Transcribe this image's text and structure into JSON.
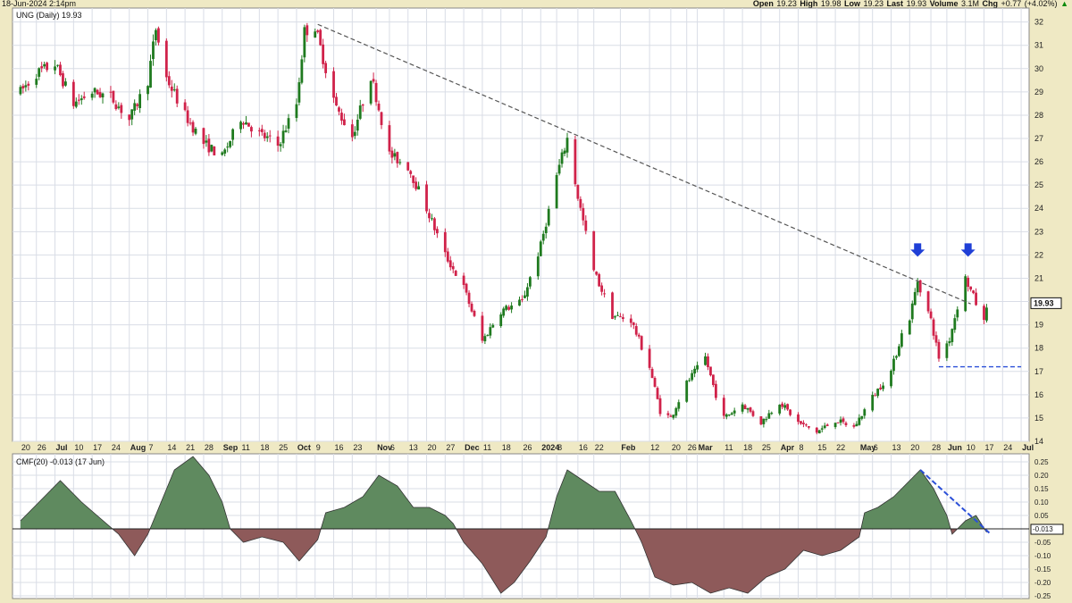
{
  "header": {
    "timestamp": "18-Jun-2024 2:14pm",
    "open_label": "Open",
    "open": "19.23",
    "high_label": "High",
    "high": "19.98",
    "low_label": "Low",
    "low": "19.23",
    "last_label": "Last",
    "last": "19.93",
    "volume_label": "Volume",
    "volume": "3.1M",
    "chg_label": "Chg",
    "chg": "+0.77 (+4.02%)",
    "chg_arrow": "▲"
  },
  "colors": {
    "background": "#efe9c4",
    "panel": "#ffffff",
    "grid": "#d9dde6",
    "up_candle": "#1f7a1f",
    "down_candle": "#d0224a",
    "trendline": "#555555",
    "arrow": "#1f3fd6",
    "support_line": "#2b4fd8",
    "cmf_positive": "#5f8a5f",
    "cmf_negative": "#8e5a5a",
    "header_up": "#0a8a0a"
  },
  "chart_data": [
    {
      "type": "candlestick",
      "title": "UNG (Daily) 19.93",
      "ylim": [
        14,
        32.6
      ],
      "yticks": [
        14,
        15,
        16,
        17,
        18,
        19,
        20,
        21,
        22,
        23,
        24,
        25,
        26,
        27,
        28,
        29,
        30,
        31,
        32
      ],
      "last_value_label": "19.93",
      "x_tick_labels": [
        "20",
        "26",
        "Jul",
        "10",
        "17",
        "24",
        "Aug",
        "7",
        "14",
        "21",
        "28",
        "Sep",
        "11",
        "18",
        "25",
        "Oct",
        "9",
        "16",
        "23",
        "Nov",
        "6",
        "13",
        "20",
        "27",
        "Dec",
        "11",
        "18",
        "26",
        "2024",
        "8",
        "16",
        "22",
        "Feb",
        "12",
        "20",
        "26",
        "Mar",
        "11",
        "18",
        "25",
        "Apr",
        "8",
        "15",
        "22",
        "May",
        "6",
        "13",
        "20",
        "28",
        "Jun",
        "10",
        "17",
        "24",
        "Jul"
      ],
      "grid": true,
      "price_path": [
        [
          "2023-06-20",
          29.0
        ],
        [
          "2023-06-26",
          29.8
        ],
        [
          "2023-07-03",
          30.2
        ],
        [
          "2023-07-10",
          28.5
        ],
        [
          "2023-07-17",
          29.0
        ],
        [
          "2023-07-24",
          28.8
        ],
        [
          "2023-07-31",
          27.8
        ],
        [
          "2023-08-07",
          29.5
        ],
        [
          "2023-08-10",
          31.7
        ],
        [
          "2023-08-14",
          29.6
        ],
        [
          "2023-08-21",
          28.0
        ],
        [
          "2023-08-28",
          26.8
        ],
        [
          "2023-09-04",
          26.2
        ],
        [
          "2023-09-11",
          27.9
        ],
        [
          "2023-09-18",
          27.2
        ],
        [
          "2023-09-25",
          26.7
        ],
        [
          "2023-10-02",
          28.5
        ],
        [
          "2023-10-05",
          31.6
        ],
        [
          "2023-10-09",
          31.8
        ],
        [
          "2023-10-13",
          30.0
        ],
        [
          "2023-10-17",
          28.3
        ],
        [
          "2023-10-23",
          27.1
        ],
        [
          "2023-10-30",
          29.7
        ],
        [
          "2023-11-01",
          28.8
        ],
        [
          "2023-11-06",
          26.3
        ],
        [
          "2023-11-13",
          25.8
        ],
        [
          "2023-11-20",
          24.0
        ],
        [
          "2023-11-27",
          22.0
        ],
        [
          "2023-12-04",
          20.6
        ],
        [
          "2023-12-11",
          18.3
        ],
        [
          "2023-12-18",
          19.6
        ],
        [
          "2023-12-26",
          20.0
        ],
        [
          "2024-01-02",
          22.4
        ],
        [
          "2024-01-08",
          25.4
        ],
        [
          "2024-01-12",
          27.0
        ],
        [
          "2024-01-16",
          24.5
        ],
        [
          "2024-01-22",
          21.3
        ],
        [
          "2024-01-29",
          19.4
        ],
        [
          "2024-02-05",
          19.2
        ],
        [
          "2024-02-12",
          17.2
        ],
        [
          "2024-02-16",
          15.3
        ],
        [
          "2024-02-20",
          15.0
        ],
        [
          "2024-02-26",
          16.5
        ],
        [
          "2024-03-04",
          17.6
        ],
        [
          "2024-03-08",
          16.0
        ],
        [
          "2024-03-11",
          15.0
        ],
        [
          "2024-03-18",
          15.6
        ],
        [
          "2024-03-25",
          14.8
        ],
        [
          "2024-04-01",
          15.7
        ],
        [
          "2024-04-08",
          14.8
        ],
        [
          "2024-04-15",
          14.4
        ],
        [
          "2024-04-22",
          14.9
        ],
        [
          "2024-04-29",
          14.6
        ],
        [
          "2024-05-06",
          15.9
        ],
        [
          "2024-05-13",
          17.0
        ],
        [
          "2024-05-17",
          18.6
        ],
        [
          "2024-05-20",
          19.3
        ],
        [
          "2024-05-23",
          20.9
        ],
        [
          "2024-05-28",
          19.2
        ],
        [
          "2024-05-31",
          17.6
        ],
        [
          "2024-06-04",
          18.4
        ],
        [
          "2024-06-07",
          19.8
        ],
        [
          "2024-06-10",
          21.0
        ],
        [
          "2024-06-13",
          20.2
        ],
        [
          "2024-06-17",
          19.1
        ],
        [
          "2024-06-18",
          19.9
        ]
      ],
      "annotations": {
        "trendline": {
          "from": [
            "2023-10-10",
            31.9
          ],
          "to": [
            "2024-06-12",
            19.9
          ],
          "style": "dashed"
        },
        "down_arrows": [
          [
            "2024-05-23",
            22.0
          ],
          [
            "2024-06-11",
            22.0
          ]
        ],
        "support_line": {
          "from": [
            "2024-05-31",
            17.2
          ],
          "to": [
            "2024-07-01",
            17.2
          ],
          "value": 17.2,
          "style": "dashed"
        }
      }
    },
    {
      "type": "area",
      "title": "CMF(20) -0.013 (17 Jun)",
      "ylim": [
        -0.26,
        0.28
      ],
      "yticks": [
        -0.25,
        -0.2,
        -0.15,
        -0.1,
        -0.05,
        0,
        0.05,
        0.1,
        0.15,
        0.2,
        0.25
      ],
      "ytick_labels": [
        "-0.25",
        "-0.20",
        "-0.15",
        "-0.10",
        "-0.05",
        "0.00",
        "0.05",
        "0.10",
        "0.15",
        "0.20",
        "0.25"
      ],
      "last_value_label": "-0.013",
      "series": [
        {
          "values": [
            [
              "2023-06-20",
              0.03
            ],
            [
              "2023-06-27",
              0.1
            ],
            [
              "2023-07-05",
              0.18
            ],
            [
              "2023-07-13",
              0.1
            ],
            [
              "2023-07-20",
              0.04
            ],
            [
              "2023-07-27",
              -0.02
            ],
            [
              "2023-08-02",
              -0.1
            ],
            [
              "2023-08-07",
              -0.02
            ],
            [
              "2023-08-12",
              0.1
            ],
            [
              "2023-08-17",
              0.22
            ],
            [
              "2023-08-24",
              0.27
            ],
            [
              "2023-08-30",
              0.2
            ],
            [
              "2023-09-04",
              0.1
            ],
            [
              "2023-09-07",
              0.0
            ],
            [
              "2023-09-12",
              -0.05
            ],
            [
              "2023-09-19",
              -0.03
            ],
            [
              "2023-09-27",
              -0.05
            ],
            [
              "2023-10-03",
              -0.12
            ],
            [
              "2023-10-10",
              -0.04
            ],
            [
              "2023-10-13",
              0.06
            ],
            [
              "2023-10-20",
              0.08
            ],
            [
              "2023-10-27",
              0.12
            ],
            [
              "2023-11-02",
              0.2
            ],
            [
              "2023-11-09",
              0.16
            ],
            [
              "2023-11-15",
              0.08
            ],
            [
              "2023-11-21",
              0.08
            ],
            [
              "2023-11-27",
              0.05
            ],
            [
              "2023-11-30",
              0.02
            ],
            [
              "2023-12-04",
              -0.05
            ],
            [
              "2023-12-11",
              -0.13
            ],
            [
              "2023-12-18",
              -0.24
            ],
            [
              "2023-12-23",
              -0.2
            ],
            [
              "2023-12-29",
              -0.12
            ],
            [
              "2024-01-04",
              -0.03
            ],
            [
              "2024-01-08",
              0.12
            ],
            [
              "2024-01-12",
              0.22
            ],
            [
              "2024-01-18",
              0.18
            ],
            [
              "2024-01-24",
              0.14
            ],
            [
              "2024-01-30",
              0.14
            ],
            [
              "2024-02-05",
              0.03
            ],
            [
              "2024-02-09",
              -0.05
            ],
            [
              "2024-02-14",
              -0.18
            ],
            [
              "2024-02-21",
              -0.21
            ],
            [
              "2024-02-28",
              -0.2
            ],
            [
              "2024-03-06",
              -0.24
            ],
            [
              "2024-03-13",
              -0.22
            ],
            [
              "2024-03-20",
              -0.24
            ],
            [
              "2024-03-27",
              -0.18
            ],
            [
              "2024-04-03",
              -0.15
            ],
            [
              "2024-04-10",
              -0.08
            ],
            [
              "2024-04-17",
              -0.1
            ],
            [
              "2024-04-24",
              -0.08
            ],
            [
              "2024-05-01",
              -0.03
            ],
            [
              "2024-05-03",
              0.06
            ],
            [
              "2024-05-08",
              0.08
            ],
            [
              "2024-05-14",
              0.12
            ],
            [
              "2024-05-20",
              0.18
            ],
            [
              "2024-05-24",
              0.22
            ],
            [
              "2024-05-29",
              0.15
            ],
            [
              "2024-06-03",
              0.05
            ],
            [
              "2024-06-05",
              -0.02
            ],
            [
              "2024-06-10",
              0.03
            ],
            [
              "2024-06-14",
              0.05
            ],
            [
              "2024-06-18",
              -0.013
            ]
          ]
        }
      ],
      "annotations": {
        "trendline": {
          "from": [
            "2024-05-24",
            0.22
          ],
          "to": [
            "2024-06-19",
            -0.015
          ],
          "style": "dashed"
        }
      }
    }
  ]
}
